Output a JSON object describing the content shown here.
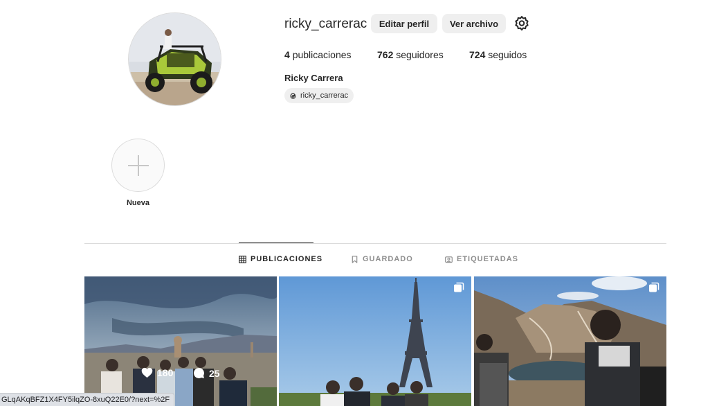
{
  "profile": {
    "username": "ricky_carrerac",
    "full_name": "Ricky Carrera",
    "threads_handle": "ricky_carrerac",
    "edit_label": "Editar perfil",
    "archive_label": "Ver archivo",
    "stats": {
      "posts_count": "4",
      "posts_label": "publicaciones",
      "followers_count": "762",
      "followers_label": "seguidores",
      "following_count": "724",
      "following_label": "seguidos"
    }
  },
  "highlights": {
    "new_label": "Nueva"
  },
  "tabs": [
    {
      "label": "PUBLICACIONES",
      "active": true,
      "icon": "grid-icon"
    },
    {
      "label": "GUARDADO",
      "active": false,
      "icon": "bookmark-icon"
    },
    {
      "label": "ETIQUETADAS",
      "active": false,
      "icon": "tagged-icon"
    }
  ],
  "posts": [
    {
      "likes": "180",
      "comments": "25",
      "hovered": true,
      "multi": false
    },
    {
      "hovered": false,
      "multi": true
    },
    {
      "hovered": false,
      "multi": true
    }
  ],
  "status_url": "GLqAKqBFZ1X4FY5ilqZO-8xuQ22E0/?next=%2F"
}
